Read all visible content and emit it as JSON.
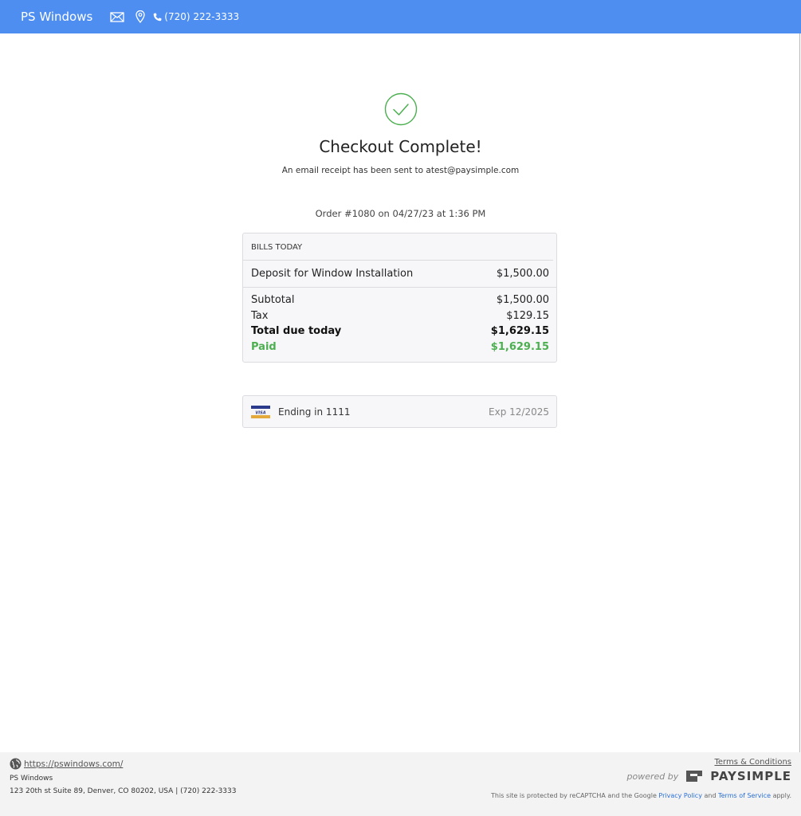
{
  "colors": {
    "brand": "#4e8ef0",
    "success": "#4caf50",
    "paid": "#4caf50"
  },
  "header": {
    "brand": "PS Windows",
    "phone": "(720) 222-3333",
    "icons": [
      "mail-icon",
      "location-pin-icon",
      "phone-icon"
    ]
  },
  "confirmation": {
    "title": "Checkout Complete!",
    "subtitle": "An email receipt has been sent to atest@paysimple.com",
    "order": "Order #1080 on 04/27/23 at 1:36 PM"
  },
  "bills": {
    "heading": "BILLS TODAY",
    "items": [
      {
        "label": "Deposit for Window Installation",
        "amount": "$1,500.00"
      }
    ],
    "subtotal_label": "Subtotal",
    "subtotal": "$1,500.00",
    "tax_label": "Tax",
    "tax": "$129.15",
    "total_label": "Total due today",
    "total": "$1,629.15",
    "paid_label": "Paid",
    "paid": "$1,629.15"
  },
  "payment": {
    "card_brand": "VISA",
    "ending": "Ending in 1111",
    "exp": "Exp 12/2025"
  },
  "footer": {
    "website": "https://pswindows.com/",
    "business_name": "PS Windows",
    "address": "123 20th st Suite 89, Denver, CO 80202, USA | (720) 222-3333",
    "terms": "Terms & Conditions",
    "powered_by": "powered by",
    "logo_text": "PAYSIMPLE",
    "recaptcha_prefix": "This site is protected by reCAPTCHA and the Google",
    "privacy_policy": "Privacy Policy",
    "and": "and",
    "terms_of_service": "Terms of Service",
    "apply": "apply."
  }
}
